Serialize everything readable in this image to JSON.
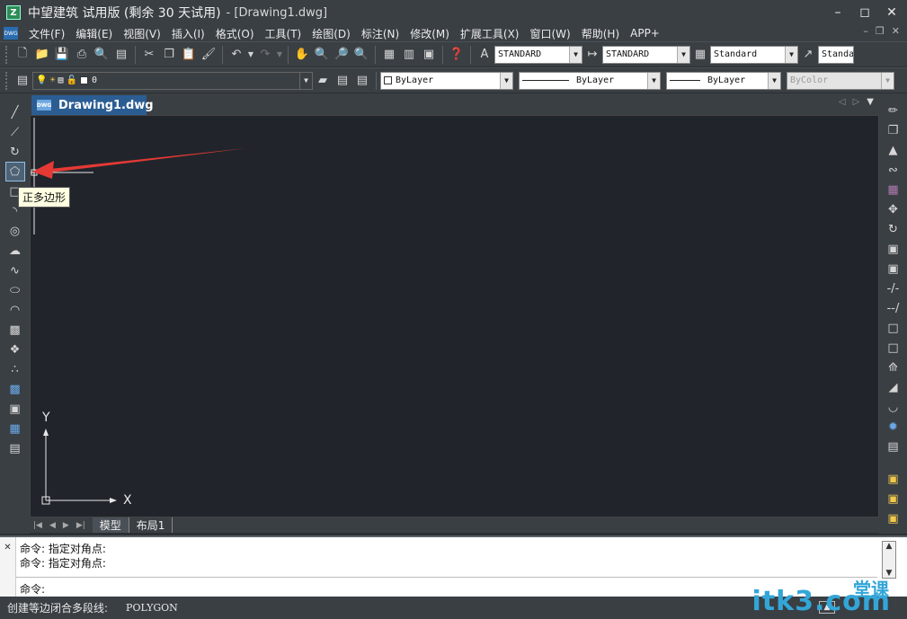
{
  "window": {
    "title": "中望建筑 试用版 (剩余 30 天试用)",
    "document": "- [Drawing1.dwg]",
    "logo": "Z"
  },
  "menu": {
    "items": [
      "文件(F)",
      "编辑(E)",
      "视图(V)",
      "插入(I)",
      "格式(O)",
      "工具(T)",
      "绘图(D)",
      "标注(N)",
      "修改(M)",
      "扩展工具(X)",
      "窗口(W)",
      "帮助(H)",
      "APP+"
    ]
  },
  "toolbar": {
    "text_style": "STANDARD",
    "dim_style": "STANDARD",
    "table_style": "Standard",
    "multileader_style": "Standa",
    "layer": "0",
    "color": "ByLayer",
    "linetype": "ByLayer",
    "lineweight": "ByLayer",
    "plot_style": "ByColor"
  },
  "tabs": {
    "document": "Drawing1.dwg"
  },
  "canvas": {
    "bg": "#21252b",
    "x_axis_label": "X",
    "y_axis_label": "Y"
  },
  "layouts": [
    "模型",
    "布局1"
  ],
  "tooltip": "正多边形",
  "command": {
    "history": [
      "命令:  指定对角点:",
      "命令:  指定对角点:"
    ],
    "prompt": "命令:"
  },
  "status": {
    "text": "创建等边闭合多段线:",
    "command": "POLYGON"
  },
  "watermark": {
    "main": "itk3.com",
    "sub": "堂课"
  },
  "colors": {
    "accent": "#2b5d93",
    "arrow": "#e53935",
    "watermark": "#33a6d8"
  }
}
